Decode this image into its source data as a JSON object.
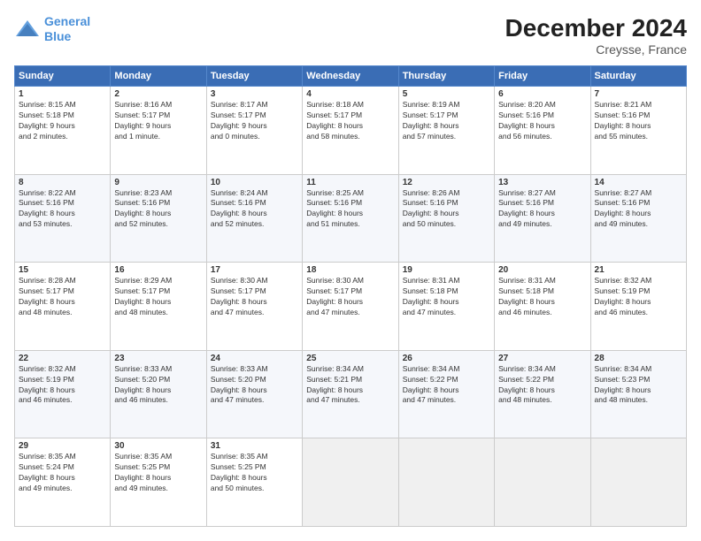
{
  "header": {
    "logo_line1": "General",
    "logo_line2": "Blue",
    "month": "December 2024",
    "location": "Creysse, France"
  },
  "weekdays": [
    "Sunday",
    "Monday",
    "Tuesday",
    "Wednesday",
    "Thursday",
    "Friday",
    "Saturday"
  ],
  "weeks": [
    [
      {
        "day": "1",
        "info": "Sunrise: 8:15 AM\nSunset: 5:18 PM\nDaylight: 9 hours\nand 2 minutes."
      },
      {
        "day": "2",
        "info": "Sunrise: 8:16 AM\nSunset: 5:17 PM\nDaylight: 9 hours\nand 1 minute."
      },
      {
        "day": "3",
        "info": "Sunrise: 8:17 AM\nSunset: 5:17 PM\nDaylight: 9 hours\nand 0 minutes."
      },
      {
        "day": "4",
        "info": "Sunrise: 8:18 AM\nSunset: 5:17 PM\nDaylight: 8 hours\nand 58 minutes."
      },
      {
        "day": "5",
        "info": "Sunrise: 8:19 AM\nSunset: 5:17 PM\nDaylight: 8 hours\nand 57 minutes."
      },
      {
        "day": "6",
        "info": "Sunrise: 8:20 AM\nSunset: 5:16 PM\nDaylight: 8 hours\nand 56 minutes."
      },
      {
        "day": "7",
        "info": "Sunrise: 8:21 AM\nSunset: 5:16 PM\nDaylight: 8 hours\nand 55 minutes."
      }
    ],
    [
      {
        "day": "8",
        "info": "Sunrise: 8:22 AM\nSunset: 5:16 PM\nDaylight: 8 hours\nand 53 minutes."
      },
      {
        "day": "9",
        "info": "Sunrise: 8:23 AM\nSunset: 5:16 PM\nDaylight: 8 hours\nand 52 minutes."
      },
      {
        "day": "10",
        "info": "Sunrise: 8:24 AM\nSunset: 5:16 PM\nDaylight: 8 hours\nand 52 minutes."
      },
      {
        "day": "11",
        "info": "Sunrise: 8:25 AM\nSunset: 5:16 PM\nDaylight: 8 hours\nand 51 minutes."
      },
      {
        "day": "12",
        "info": "Sunrise: 8:26 AM\nSunset: 5:16 PM\nDaylight: 8 hours\nand 50 minutes."
      },
      {
        "day": "13",
        "info": "Sunrise: 8:27 AM\nSunset: 5:16 PM\nDaylight: 8 hours\nand 49 minutes."
      },
      {
        "day": "14",
        "info": "Sunrise: 8:27 AM\nSunset: 5:16 PM\nDaylight: 8 hours\nand 49 minutes."
      }
    ],
    [
      {
        "day": "15",
        "info": "Sunrise: 8:28 AM\nSunset: 5:17 PM\nDaylight: 8 hours\nand 48 minutes."
      },
      {
        "day": "16",
        "info": "Sunrise: 8:29 AM\nSunset: 5:17 PM\nDaylight: 8 hours\nand 48 minutes."
      },
      {
        "day": "17",
        "info": "Sunrise: 8:30 AM\nSunset: 5:17 PM\nDaylight: 8 hours\nand 47 minutes."
      },
      {
        "day": "18",
        "info": "Sunrise: 8:30 AM\nSunset: 5:17 PM\nDaylight: 8 hours\nand 47 minutes."
      },
      {
        "day": "19",
        "info": "Sunrise: 8:31 AM\nSunset: 5:18 PM\nDaylight: 8 hours\nand 47 minutes."
      },
      {
        "day": "20",
        "info": "Sunrise: 8:31 AM\nSunset: 5:18 PM\nDaylight: 8 hours\nand 46 minutes."
      },
      {
        "day": "21",
        "info": "Sunrise: 8:32 AM\nSunset: 5:19 PM\nDaylight: 8 hours\nand 46 minutes."
      }
    ],
    [
      {
        "day": "22",
        "info": "Sunrise: 8:32 AM\nSunset: 5:19 PM\nDaylight: 8 hours\nand 46 minutes."
      },
      {
        "day": "23",
        "info": "Sunrise: 8:33 AM\nSunset: 5:20 PM\nDaylight: 8 hours\nand 46 minutes."
      },
      {
        "day": "24",
        "info": "Sunrise: 8:33 AM\nSunset: 5:20 PM\nDaylight: 8 hours\nand 47 minutes."
      },
      {
        "day": "25",
        "info": "Sunrise: 8:34 AM\nSunset: 5:21 PM\nDaylight: 8 hours\nand 47 minutes."
      },
      {
        "day": "26",
        "info": "Sunrise: 8:34 AM\nSunset: 5:22 PM\nDaylight: 8 hours\nand 47 minutes."
      },
      {
        "day": "27",
        "info": "Sunrise: 8:34 AM\nSunset: 5:22 PM\nDaylight: 8 hours\nand 48 minutes."
      },
      {
        "day": "28",
        "info": "Sunrise: 8:34 AM\nSunset: 5:23 PM\nDaylight: 8 hours\nand 48 minutes."
      }
    ],
    [
      {
        "day": "29",
        "info": "Sunrise: 8:35 AM\nSunset: 5:24 PM\nDaylight: 8 hours\nand 49 minutes."
      },
      {
        "day": "30",
        "info": "Sunrise: 8:35 AM\nSunset: 5:25 PM\nDaylight: 8 hours\nand 49 minutes."
      },
      {
        "day": "31",
        "info": "Sunrise: 8:35 AM\nSunset: 5:25 PM\nDaylight: 8 hours\nand 50 minutes."
      },
      {
        "day": "",
        "info": ""
      },
      {
        "day": "",
        "info": ""
      },
      {
        "day": "",
        "info": ""
      },
      {
        "day": "",
        "info": ""
      }
    ]
  ]
}
